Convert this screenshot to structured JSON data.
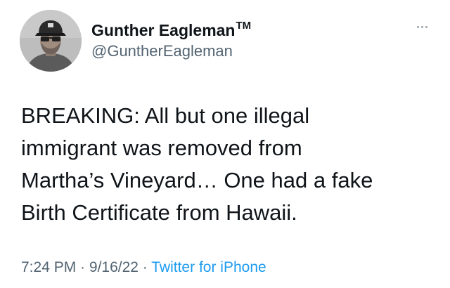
{
  "user": {
    "display_name": "Gunther Eagleman",
    "trademark": "TM",
    "handle": "@GuntherEagleman",
    "avatar_icon": "profile-photo-man-cap-sunglasses"
  },
  "more_icon": "more-options-icon",
  "tweet": {
    "lines": [
      "BREAKING: All but one illegal",
      "immigrant was removed from",
      "Martha’s Vineyard…  One had a fake",
      "Birth Certificate from Hawaii."
    ]
  },
  "meta": {
    "time": "7:24 PM",
    "separator1": " · ",
    "date": "9/16/22",
    "separator2": " · ",
    "source": "Twitter for iPhone"
  },
  "colors": {
    "text": "#0f1419",
    "secondary": "#536471",
    "link": "#1d9bf0"
  }
}
